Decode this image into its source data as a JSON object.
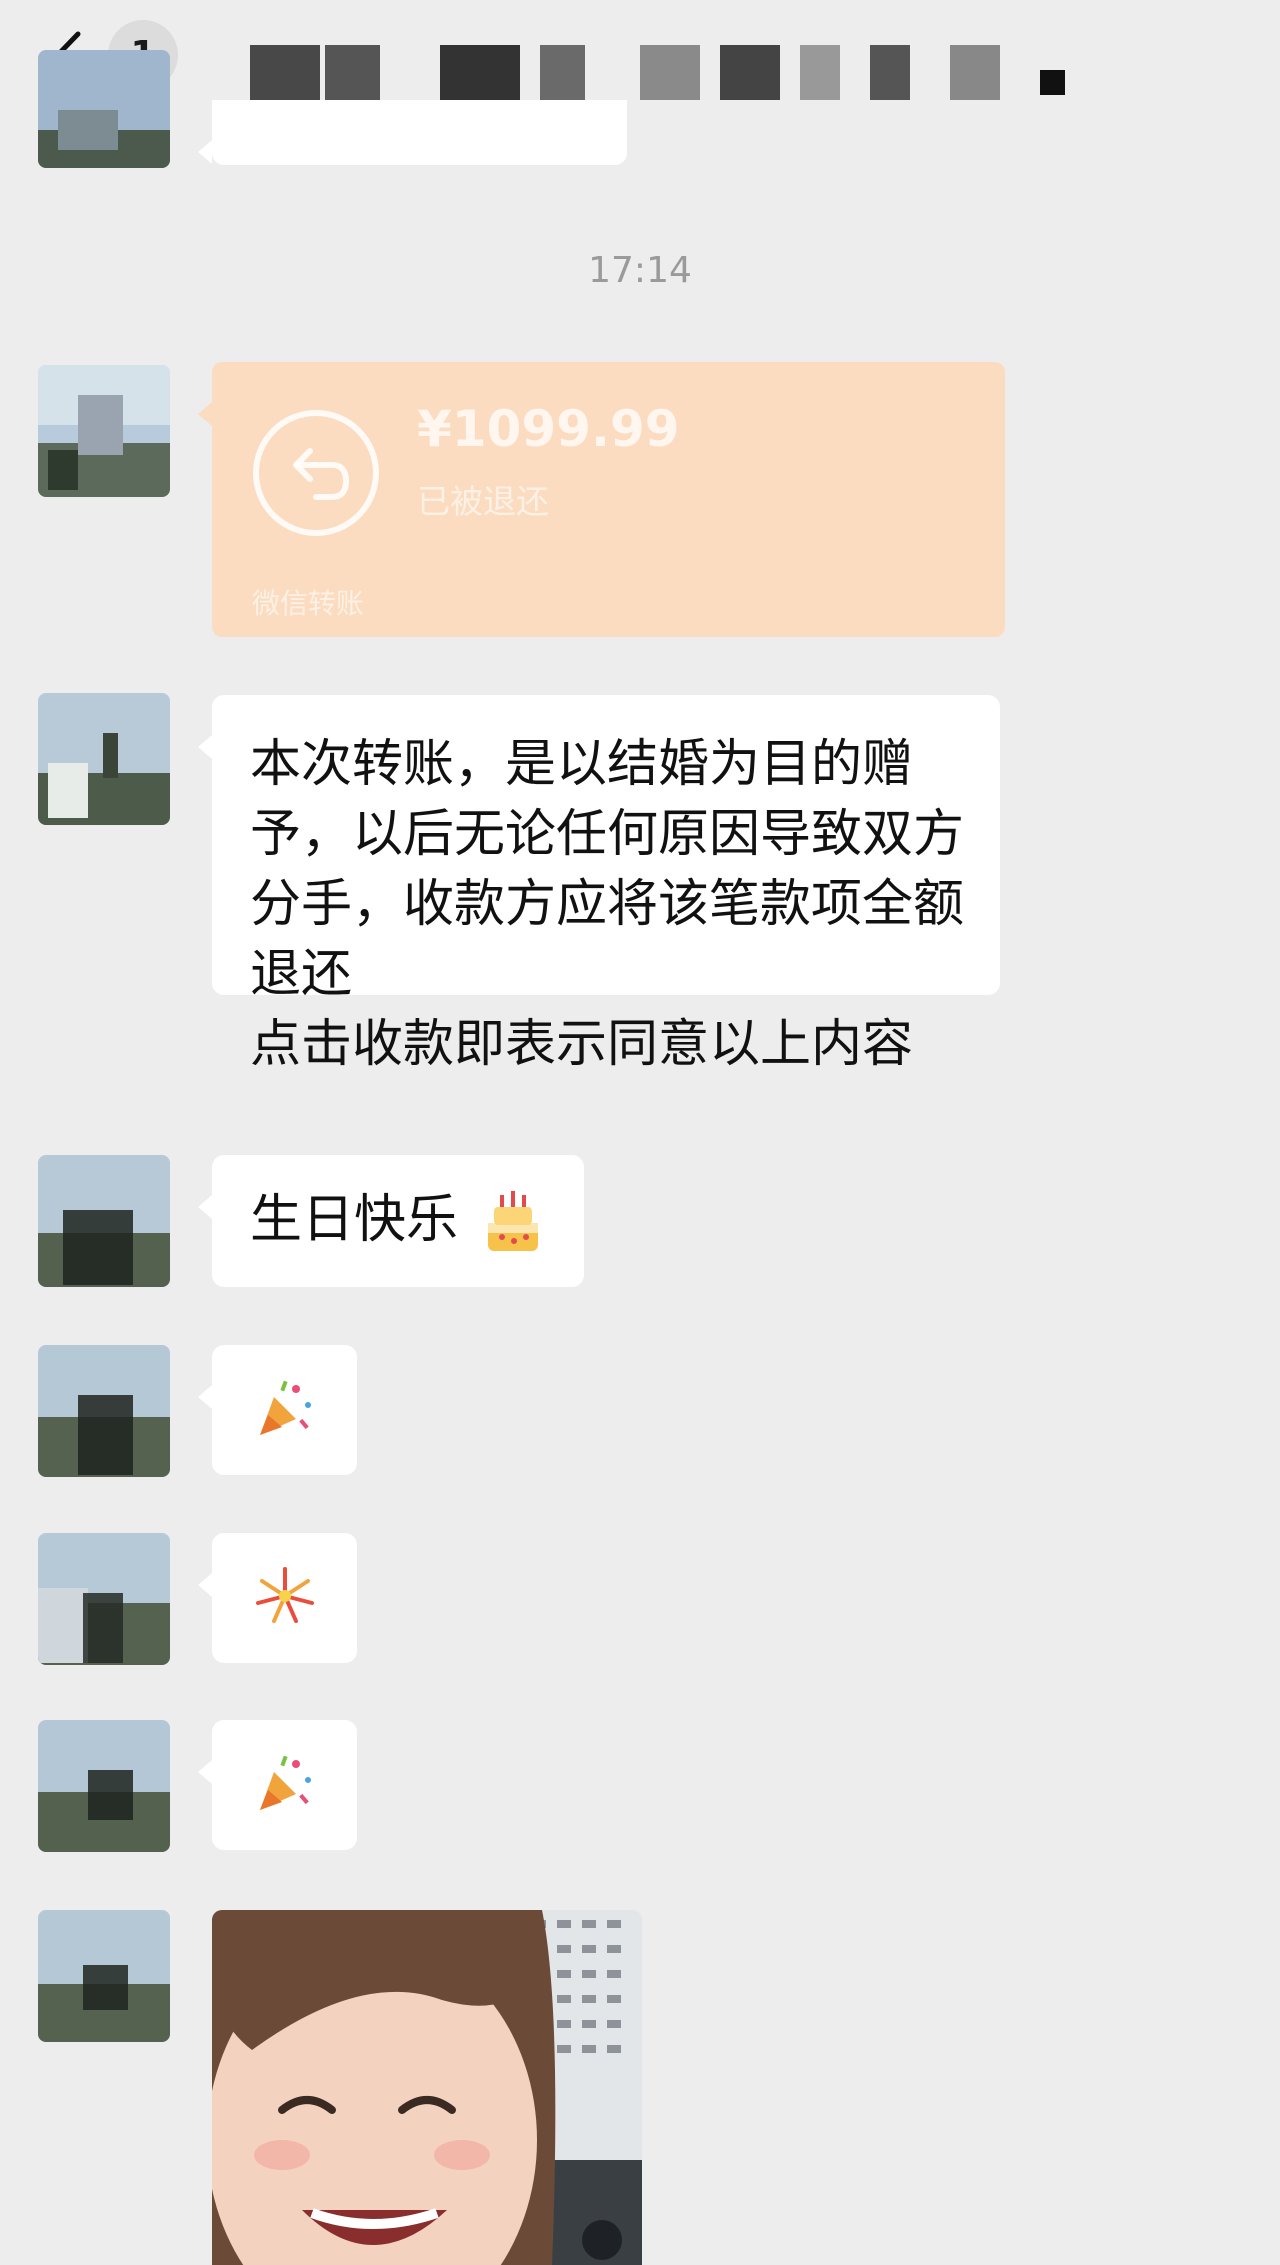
{
  "header": {
    "back_icon": "chevron-left-icon",
    "unread_count": "1",
    "title_blurred": true
  },
  "chat": {
    "timestamp": "17:14",
    "transfer": {
      "amount": "¥1099.99",
      "status": "已被退还",
      "footer": "微信转账",
      "icon": "return-arrow-icon"
    },
    "messages": [
      {
        "text_lines": [
          "本次转账，是以结婚为目的赠",
          "予，以后无论任何原因导致双方",
          "分手，收款方应将该笔款项全额",
          "退还",
          "点击收款即表示同意以上内容"
        ]
      },
      {
        "text": "生日快乐",
        "emoji": "birthday-cake-icon"
      },
      {
        "emoji": "party-popper-icon"
      },
      {
        "emoji": "fireworks-icon"
      },
      {
        "emoji": "party-popper-icon"
      }
    ],
    "photo": "smiling-child-photo"
  },
  "colors": {
    "background": "#ededed",
    "bubble": "#ffffff",
    "transfer": "#fbdcc0",
    "timestamp": "#9a9a9a"
  }
}
